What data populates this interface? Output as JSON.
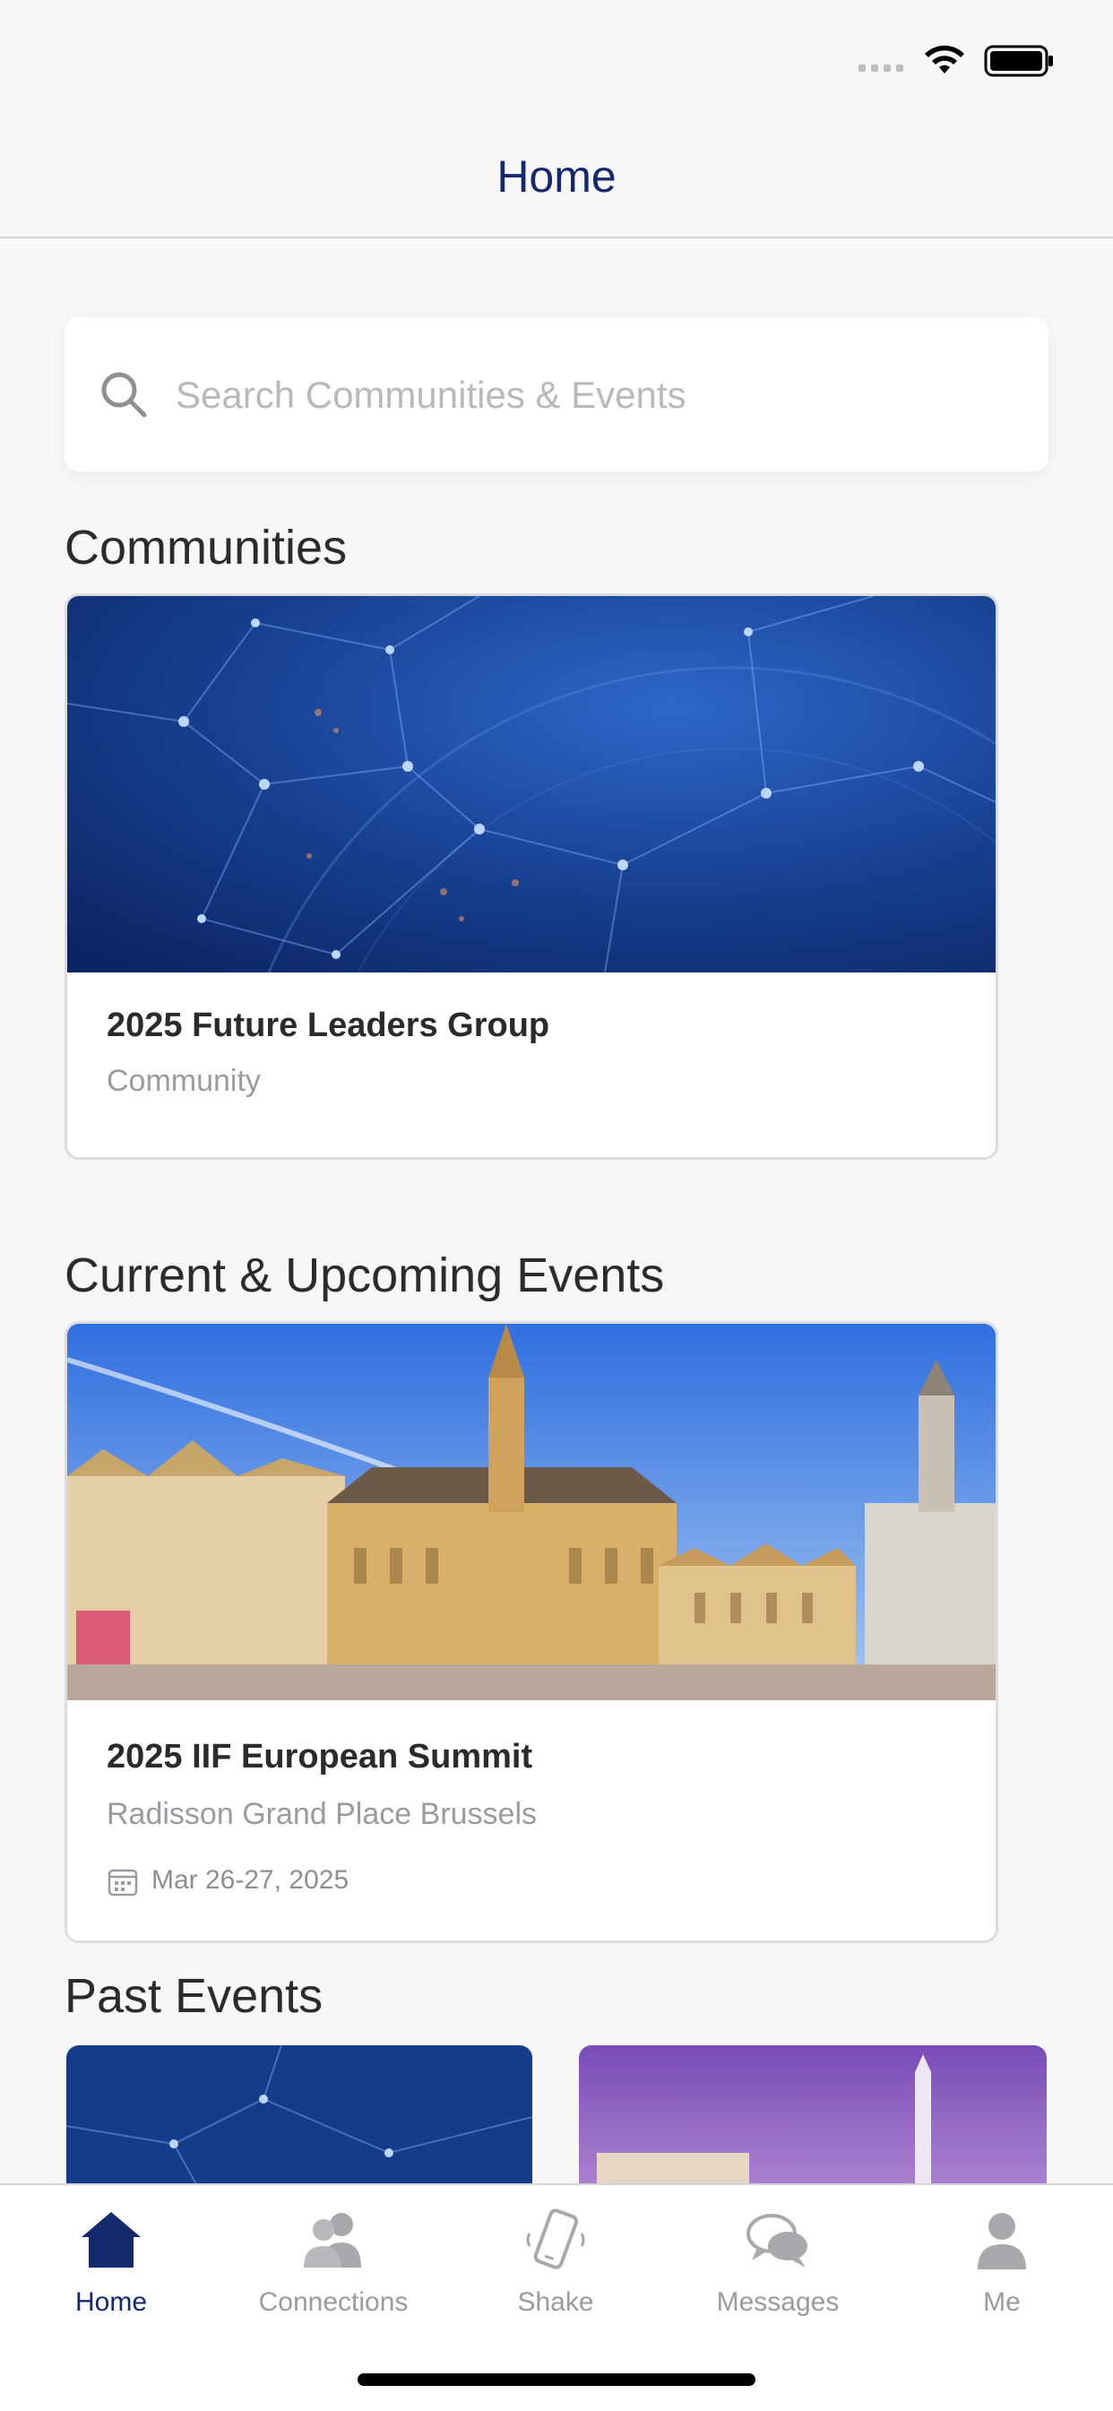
{
  "app": {
    "title": "Home"
  },
  "search": {
    "placeholder": "Search Communities & Events"
  },
  "sections": {
    "communities": "Communities",
    "upcoming": "Current & Upcoming Events",
    "past": "Past Events"
  },
  "community_card": {
    "title": "2025 Future Leaders Group",
    "subtitle": "Community"
  },
  "event_card": {
    "title": "2025 IIF European Summit",
    "venue": "Radisson Grand Place Brussels",
    "date": "Mar 26-27, 2025"
  },
  "tabs": [
    {
      "label": "Home",
      "icon": "home-icon",
      "active": true
    },
    {
      "label": "Connections",
      "icon": "connections-icon",
      "active": false
    },
    {
      "label": "Shake",
      "icon": "shake-phone-icon",
      "active": false
    },
    {
      "label": "Messages",
      "icon": "messages-icon",
      "active": false
    },
    {
      "label": "Me",
      "icon": "person-icon",
      "active": false
    }
  ],
  "colors": {
    "accent": "#14286e",
    "inactive": "#9a9aa0",
    "background": "#f7f7f8"
  }
}
